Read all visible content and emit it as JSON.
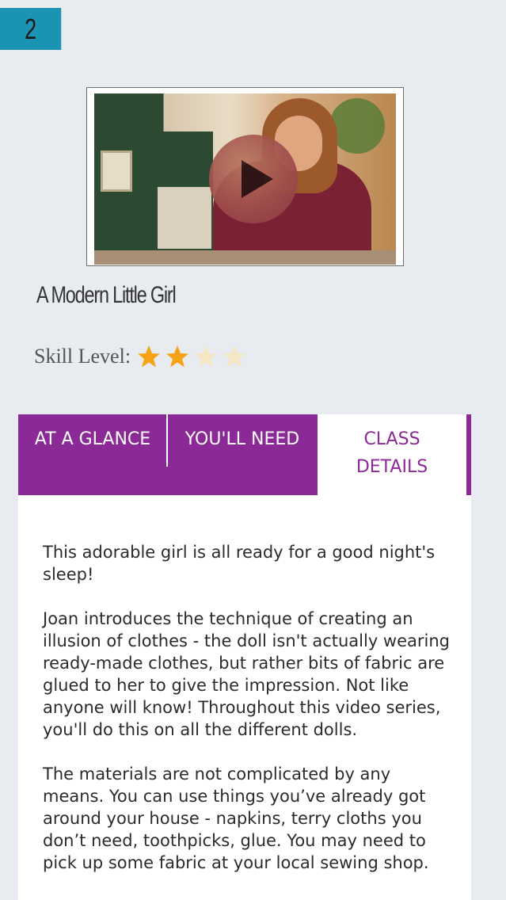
{
  "lesson": {
    "number": "2"
  },
  "video": {
    "play_label": "Play"
  },
  "class": {
    "title": "A Modern Little Girl",
    "skill_label": "Skill Level:",
    "skill_rating": 2,
    "skill_max": 4
  },
  "tabs": [
    {
      "label": "AT A GLANCE",
      "active": false
    },
    {
      "label": "YOU'LL NEED",
      "active": false
    },
    {
      "label": "CLASS DETAILS",
      "active": true
    }
  ],
  "details": {
    "paragraphs": [
      "This adorable girl is all ready for a good night's sleep!",
      "Joan introduces the technique of creating an illusion of clothes - the doll isn't actually wearing ready-made clothes, but rather bits of fabric are glued to her to give the impression. Not like anyone will know! Throughout this video series, you'll do this on all the different dolls.",
      "The materials are not complicated by any means. You can use things you’ve already got around your house - napkins, terry cloths you don’t need, toothpicks, glue. You may need to pick up some fabric at your local sewing shop."
    ]
  },
  "colors": {
    "accent": "#8b2a97",
    "lesson_badge": "#1b93b3",
    "star_filled": "#f5a315",
    "star_empty": "#f5e6c4"
  }
}
